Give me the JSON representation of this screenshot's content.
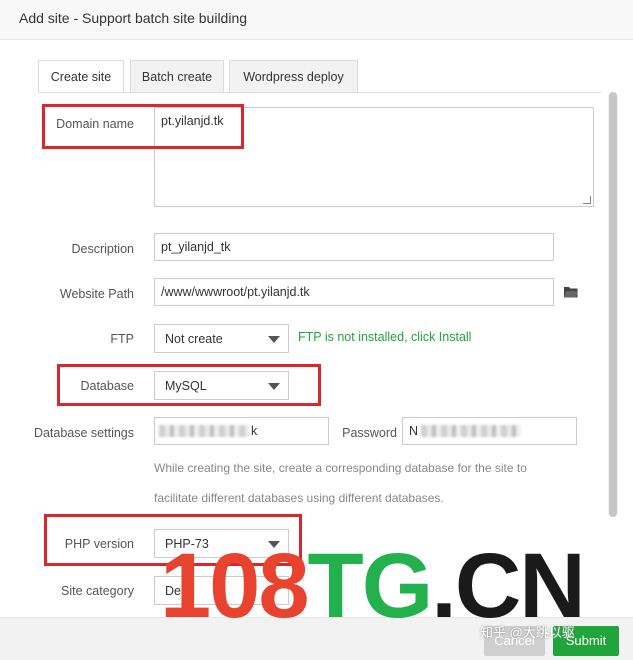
{
  "dialog": {
    "title": "Add site - Support batch site building"
  },
  "tabs": [
    "Create site",
    "Batch create",
    "Wordpress deploy"
  ],
  "form": {
    "domain_label": "Domain name",
    "domain_value": "pt.yilanjd.tk",
    "description_label": "Description",
    "description_value": "pt_yilanjd_tk",
    "path_label": "Website Path",
    "path_value": "/www/wwwroot/pt.yilanjd.tk",
    "ftp_label": "FTP",
    "ftp_value": "Not create",
    "ftp_hint": "FTP is not installed, click Install",
    "database_label": "Database",
    "database_value": "MySQL",
    "db_settings_label": "Database settings",
    "db_user_suffix": "k",
    "password_label": "Password",
    "password_prefix": "N",
    "db_hint_line1": "While creating the site, create a corresponding database for the site to",
    "db_hint_line2": "facilitate different databases using different databases.",
    "php_label": "PHP version",
    "php_value": "PHP-73",
    "category_label": "Site category",
    "category_value": "De"
  },
  "buttons": {
    "cancel": "Cancel",
    "submit": "Submit"
  },
  "watermark": {
    "part1": "108",
    "part2": "TG",
    "part3": ".CN",
    "zh": "知乎 @大跳以驱"
  },
  "colors": {
    "accent": "#20a53a",
    "highlight": "#d9282d"
  },
  "icons": {
    "folder": "folder-icon"
  }
}
